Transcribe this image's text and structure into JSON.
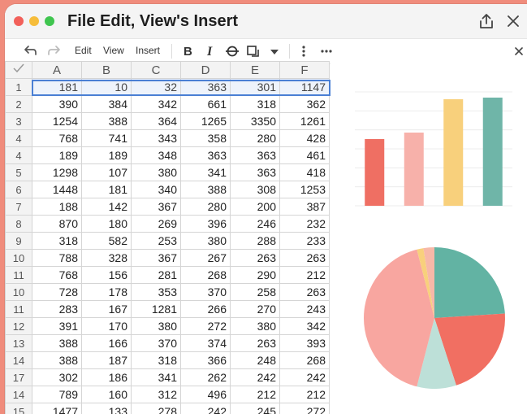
{
  "window": {
    "title": "File Edit, View's Insert",
    "traffic_lights": [
      "#f2605a",
      "#f6bd3b",
      "#3fc54f"
    ]
  },
  "toolbar": {
    "items": [
      "Edit",
      "View",
      "Insert"
    ],
    "icons": [
      "undo-icon",
      "redo-icon",
      "bold-icon",
      "italic-icon",
      "strikethrough-icon",
      "border-icon",
      "dropdown-icon",
      "vertical-more-icon",
      "more-icon",
      "close-panel-icon"
    ]
  },
  "sheet": {
    "columns": [
      "A",
      "B",
      "C",
      "D",
      "E",
      "F"
    ],
    "rows": [
      {
        "label": "1",
        "cells": [
          "181",
          "10",
          "32",
          "363",
          "301",
          "1147"
        ]
      },
      {
        "label": "2",
        "cells": [
          "390",
          "384",
          "342",
          "661",
          "318",
          "362"
        ]
      },
      {
        "label": "3",
        "cells": [
          "1254",
          "388",
          "364",
          "1265",
          "3350",
          "1261"
        ]
      },
      {
        "label": "4",
        "cells": [
          "768",
          "741",
          "343",
          "358",
          "280",
          "428"
        ]
      },
      {
        "label": "4",
        "cells": [
          "189",
          "189",
          "348",
          "363",
          "363",
          "461"
        ]
      },
      {
        "label": "5",
        "cells": [
          "1298",
          "107",
          "380",
          "341",
          "363",
          "418"
        ]
      },
      {
        "label": "6",
        "cells": [
          "1448",
          "181",
          "340",
          "388",
          "308",
          "1253"
        ]
      },
      {
        "label": "7",
        "cells": [
          "188",
          "142",
          "367",
          "280",
          "200",
          "387"
        ]
      },
      {
        "label": "8",
        "cells": [
          "870",
          "180",
          "269",
          "396",
          "246",
          "232"
        ]
      },
      {
        "label": "9",
        "cells": [
          "318",
          "582",
          "253",
          "380",
          "288",
          "233"
        ]
      },
      {
        "label": "10",
        "cells": [
          "788",
          "328",
          "367",
          "267",
          "263",
          "263"
        ]
      },
      {
        "label": "11",
        "cells": [
          "768",
          "156",
          "281",
          "268",
          "290",
          "212"
        ]
      },
      {
        "label": "10",
        "cells": [
          "728",
          "178",
          "353",
          "370",
          "258",
          "263"
        ]
      },
      {
        "label": "11",
        "cells": [
          "283",
          "167",
          "1281",
          "266",
          "270",
          "243"
        ]
      },
      {
        "label": "12",
        "cells": [
          "391",
          "170",
          "380",
          "272",
          "380",
          "342"
        ]
      },
      {
        "label": "13",
        "cells": [
          "388",
          "166",
          "370",
          "374",
          "263",
          "393"
        ]
      },
      {
        "label": "14",
        "cells": [
          "388",
          "187",
          "318",
          "366",
          "248",
          "268"
        ]
      },
      {
        "label": "17",
        "cells": [
          "302",
          "186",
          "341",
          "262",
          "242",
          "242"
        ]
      },
      {
        "label": "14",
        "cells": [
          "789",
          "160",
          "312",
          "496",
          "212",
          "212"
        ]
      },
      {
        "label": "15",
        "cells": [
          "1477",
          "133",
          "278",
          "242",
          "245",
          "272"
        ]
      }
    ]
  },
  "chart_data": [
    {
      "type": "bar",
      "categories": [
        "",
        "",
        "",
        ""
      ],
      "values": [
        82,
        90,
        131,
        133
      ],
      "colors": [
        "#ef6f63",
        "#f7b1aa",
        "#f8d07c",
        "#6fb5a8"
      ],
      "ylim": [
        0,
        140
      ],
      "grid": true
    },
    {
      "type": "pie",
      "values": [
        24,
        21,
        9,
        42,
        1.5,
        2.5
      ],
      "colors": [
        "#62b3a3",
        "#f16f62",
        "#bde0d8",
        "#f8a6a0",
        "#f8d07c",
        "#f7b8a8"
      ]
    }
  ]
}
